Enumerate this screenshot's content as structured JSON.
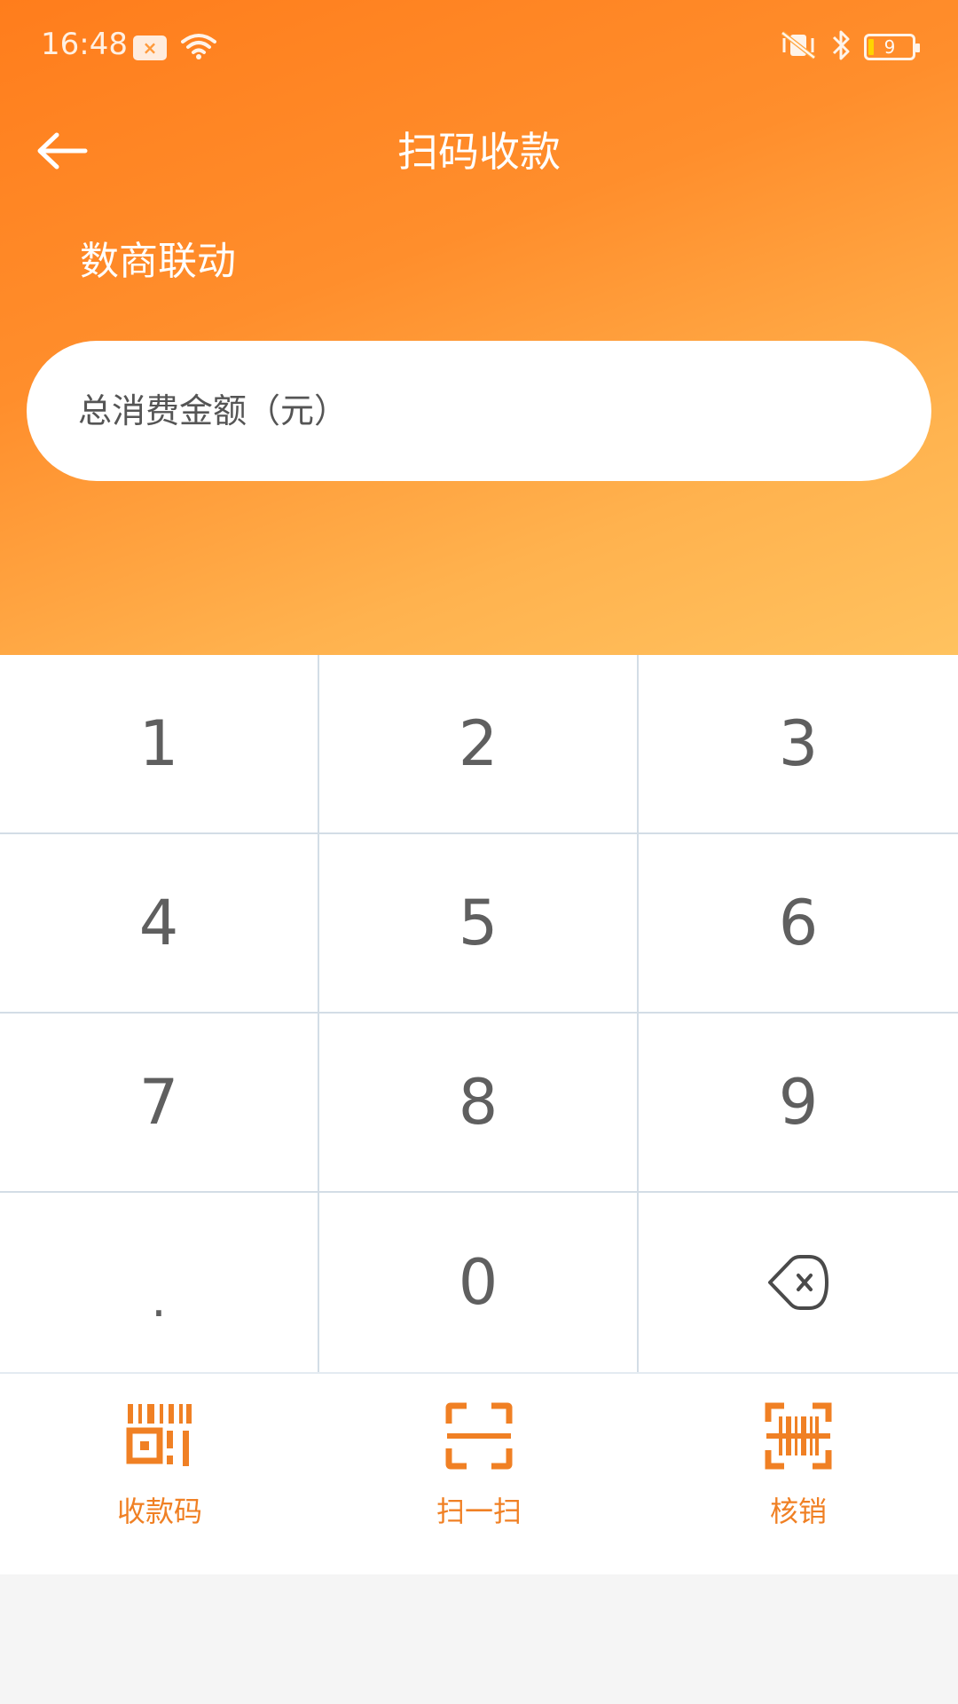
{
  "status_bar": {
    "time": "16:48",
    "battery_level": "9",
    "icons": [
      "notification-icon",
      "wifi-icon",
      "vibrate-mute-icon",
      "bluetooth-icon",
      "battery-icon"
    ]
  },
  "nav": {
    "title": "扫码收款",
    "back_icon": "arrow-left-icon"
  },
  "merchant": {
    "name": "数商联动"
  },
  "amount_input": {
    "placeholder": "总消费金额（元）",
    "value": ""
  },
  "keypad": {
    "keys": [
      "1",
      "2",
      "3",
      "4",
      "5",
      "6",
      "7",
      "8",
      "9",
      ".",
      "0",
      "backspace-icon"
    ]
  },
  "actions": [
    {
      "label": "收款码",
      "icon": "payment-code-icon"
    },
    {
      "label": "扫一扫",
      "icon": "scan-icon"
    },
    {
      "label": "核销",
      "icon": "barcode-verify-icon"
    }
  ],
  "colors": {
    "header_gradient_start": "#ff7d1c",
    "header_gradient_end": "#ffc25f",
    "accent": "#f08024",
    "key_text": "#5f5f5f",
    "divider": "#d3dde6"
  }
}
